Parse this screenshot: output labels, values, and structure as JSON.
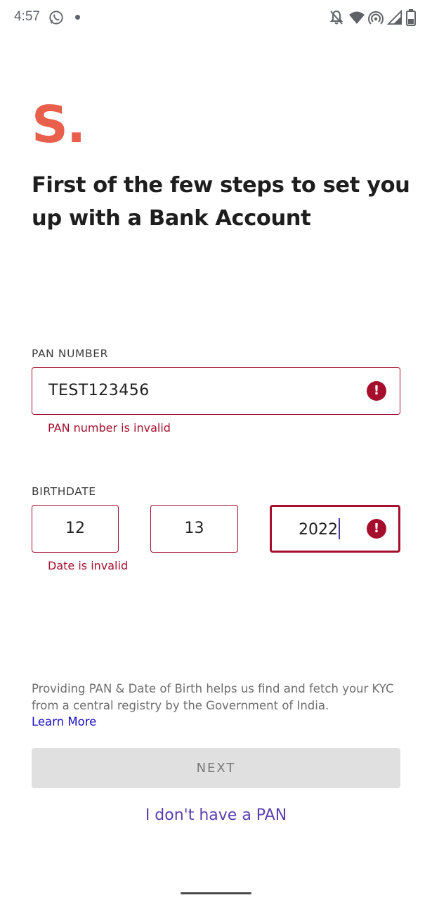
{
  "status_bar": {
    "time": "4:57",
    "icons": [
      "whatsapp-icon",
      "dot-icon",
      "notifications-off-icon",
      "wifi-icon",
      "hotspot-icon",
      "signal-icon",
      "battery-icon"
    ]
  },
  "logo": {
    "text": "S.",
    "color": "#e8604c"
  },
  "heading": "First of the few steps to set you up with a Bank Account",
  "pan": {
    "label": "PAN NUMBER",
    "value": "TEST123456",
    "error": "PAN number is invalid",
    "error_icon": "!"
  },
  "birthdate": {
    "label": "BIRTHDATE",
    "day": "12",
    "month": "13",
    "year": "2022",
    "error": "Date is invalid",
    "error_icon": "!"
  },
  "info": {
    "text": "Providing PAN & Date of Birth helps us find and fetch your KYC from a central registry by the Government of India.",
    "learn_more": "Learn More"
  },
  "next_button": "NEXT",
  "no_pan_link": "I don't have a PAN",
  "colors": {
    "accent": "#e8604c",
    "error": "#a50f2d",
    "link": "#1a10c4",
    "secondary_link": "#5b3fb0",
    "disabled_button": "#e0e0e0"
  }
}
